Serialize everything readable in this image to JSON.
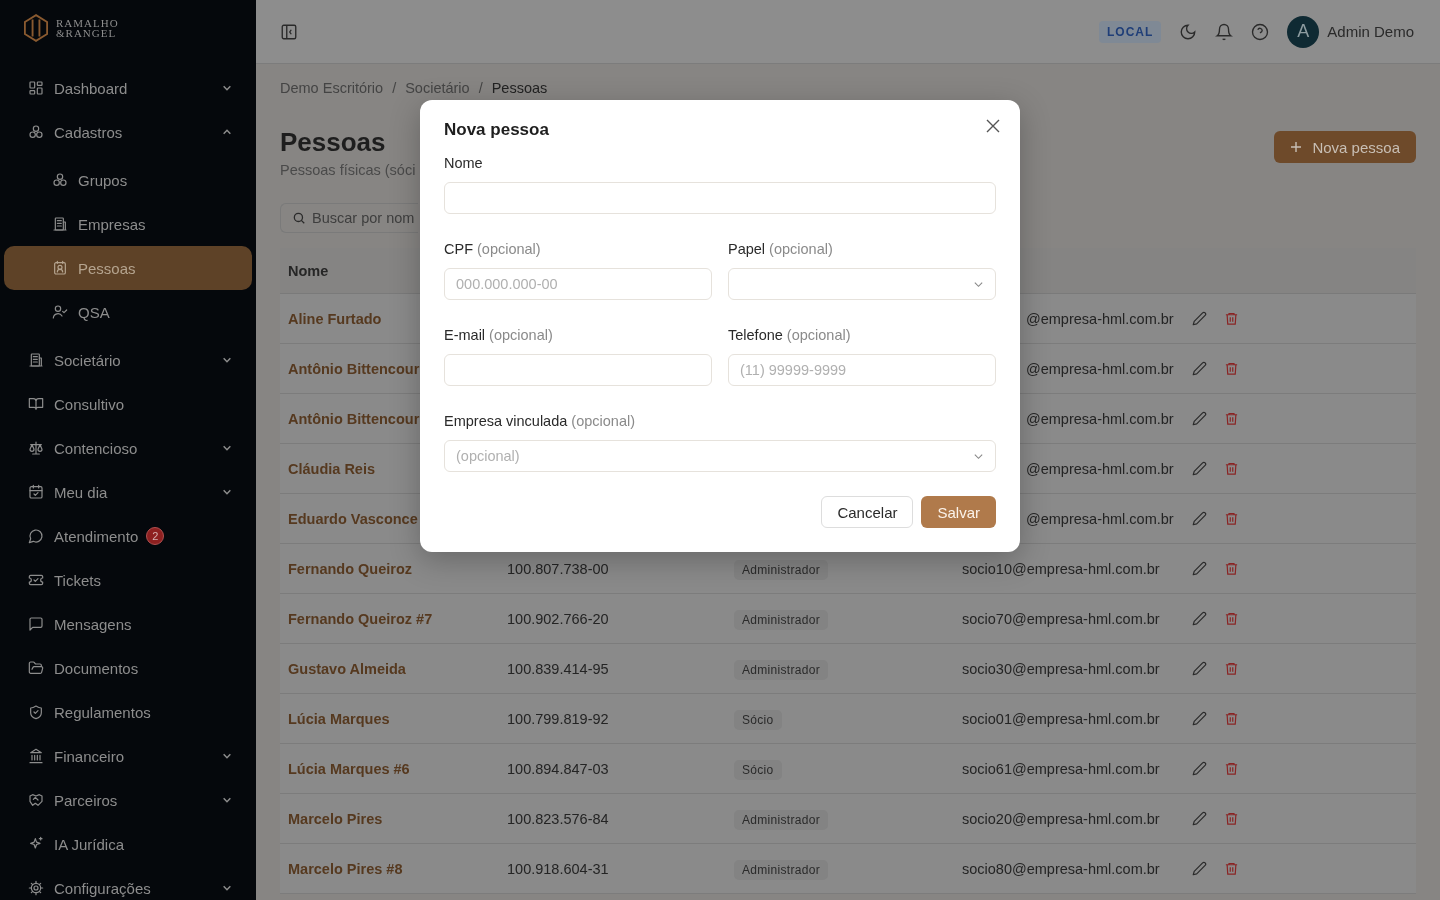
{
  "logo": {
    "line_1": "RAMALHO",
    "line_2": "&RANGEL"
  },
  "sidebar": {
    "items": [
      {
        "label": "Dashboard",
        "expanded": false
      },
      {
        "label": "Cadastros",
        "expanded": true,
        "children": [
          {
            "label": "Grupos",
            "selected": false
          },
          {
            "label": "Empresas",
            "selected": false
          },
          {
            "label": "Pessoas",
            "selected": true
          },
          {
            "label": "QSA",
            "selected": false
          }
        ]
      },
      {
        "label": "Societário",
        "expanded": false
      },
      {
        "label": "Consultivo"
      },
      {
        "label": "Contencioso",
        "expanded": false
      },
      {
        "label": "Meu dia",
        "expanded": false
      },
      {
        "label": "Atendimento",
        "badge": "2"
      },
      {
        "label": "Tickets"
      },
      {
        "label": "Mensagens"
      },
      {
        "label": "Documentos"
      },
      {
        "label": "Regulamentos"
      },
      {
        "label": "Financeiro",
        "expanded": false
      },
      {
        "label": "Parceiros",
        "expanded": false
      },
      {
        "label": "IA Jurídica"
      },
      {
        "label": "Configurações",
        "expanded": false
      }
    ]
  },
  "topbar": {
    "environment": "LOCAL",
    "avatar": "A",
    "user": "Admin Demo"
  },
  "breadcrumb": [
    {
      "kind": "link",
      "text": "Demo Escritório"
    },
    {
      "kind": "separator",
      "text": "/"
    },
    {
      "kind": "link",
      "text": "Societário"
    },
    {
      "kind": "separator",
      "text": "/"
    },
    {
      "kind": "current",
      "text": "Pessoas"
    }
  ],
  "page": {
    "title": "Pessoas",
    "subtitle": "Pessoas físicas (sóci",
    "search_placeholder": "Buscar por nom",
    "new_button": "Nova pessoa"
  },
  "table": {
    "columns": [
      "Nome"
    ],
    "rows": [
      {
        "name": "Aline Furtado",
        "email": "@empresa-hml.com.br"
      },
      {
        "name": "Antônio Bittencour",
        "email": "@empresa-hml.com.br"
      },
      {
        "name": "Antônio Bittencour",
        "email": "@empresa-hml.com.br"
      },
      {
        "name": "Cláudia Reis",
        "email": "@empresa-hml.com.br"
      },
      {
        "name": "Eduardo Vasconce",
        "email": "@empresa-hml.com.br"
      },
      {
        "name": "Fernando Queiroz",
        "cpf": "100.807.738-00",
        "role": "Administrador",
        "email": "socio10@empresa-hml.com.br"
      },
      {
        "name": "Fernando Queiroz #7",
        "cpf": "100.902.766-20",
        "role": "Administrador",
        "email": "socio70@empresa-hml.com.br"
      },
      {
        "name": "Gustavo Almeida",
        "cpf": "100.839.414-95",
        "role": "Administrador",
        "email": "socio30@empresa-hml.com.br"
      },
      {
        "name": "Lúcia Marques",
        "cpf": "100.799.819-92",
        "role": "Sócio",
        "email": "socio01@empresa-hml.com.br"
      },
      {
        "name": "Lúcia Marques #6",
        "cpf": "100.894.847-03",
        "role": "Sócio",
        "email": "socio61@empresa-hml.com.br"
      },
      {
        "name": "Marcelo Pires",
        "cpf": "100.823.576-84",
        "role": "Administrador",
        "email": "socio20@empresa-hml.com.br"
      },
      {
        "name": "Marcelo Pires #8",
        "cpf": "100.918.604-31",
        "role": "Administrador",
        "email": "socio80@empresa-hml.com.br"
      }
    ]
  },
  "modal": {
    "title": "Nova pessoa",
    "fields": [
      {
        "label": "Nome",
        "kind": "text",
        "full_width": true
      },
      {
        "label": "CPF",
        "hint": "(opcional)",
        "kind": "text",
        "full_width": false,
        "placeholder": "000.000.000-00"
      },
      {
        "label": "Papel",
        "hint": "(opcional)",
        "kind": "select",
        "full_width": false
      },
      {
        "label": "E-mail",
        "hint": "(opcional)",
        "kind": "text",
        "full_width": false
      },
      {
        "label": "Telefone",
        "hint": "(opcional)",
        "kind": "text",
        "full_width": false,
        "placeholder": "(11) 99999-9999"
      },
      {
        "label": "Empresa vinculada",
        "hint": "(opcional)",
        "kind": "select",
        "full_width": true,
        "placeholder": "(opcional)"
      }
    ],
    "cancel": "Cancelar",
    "save": "Salvar"
  }
}
